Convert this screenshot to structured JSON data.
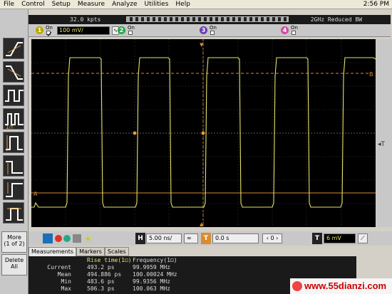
{
  "menu": [
    "File",
    "Control",
    "Setup",
    "Measure",
    "Analyze",
    "Utilities",
    "Help"
  ],
  "clock": "2:56 PM",
  "status": {
    "acquisition": "32.0 kpts",
    "sampling": "2GHz Reduced BW"
  },
  "channels": [
    {
      "num": "1",
      "on_label": "On",
      "checked": true,
      "scale": "100 mV/",
      "color": "#e7e36a"
    },
    {
      "num": "2",
      "on_label": "On",
      "checked": false,
      "color": "#29a84a"
    },
    {
      "num": "3",
      "on_label": "On",
      "checked": false,
      "color": "#6a3fb0"
    },
    {
      "num": "4",
      "on_label": "On",
      "checked": false,
      "color": "#d64aa8"
    }
  ],
  "left_panel": {
    "more_label": "More",
    "more_page": "(1 of 2)",
    "delete_label": "Delete",
    "delete_sub": "All"
  },
  "controls": {
    "h_label": "H",
    "timebase": "5.00 ns/",
    "t_label": "T",
    "delay": "0.0 s",
    "trigger_label": "T",
    "trigger_level": "6 mV"
  },
  "tabs": [
    "Measurements",
    "Markers",
    "Scales"
  ],
  "measurements": {
    "col1_header": "Rise time(1⚀)",
    "col2_header": "Frequency(1⚀)",
    "rows": [
      {
        "label": "Current",
        "rise": "493.2 ps",
        "freq": "99.9959 MHz"
      },
      {
        "label": "Mean",
        "rise": "494.886 ps",
        "freq": "100.00024 MHz"
      },
      {
        "label": "Min",
        "rise": "483.6 ps",
        "freq": "99.9356 MHz"
      },
      {
        "label": "Max",
        "rise": "506.3 ps",
        "freq": "100.063 MHz"
      }
    ]
  },
  "watermark": "www.55dianzi.com",
  "colors": {
    "trace": "#e7e36a",
    "marker": "#d98c30",
    "grid": "#5a5a5a"
  }
}
